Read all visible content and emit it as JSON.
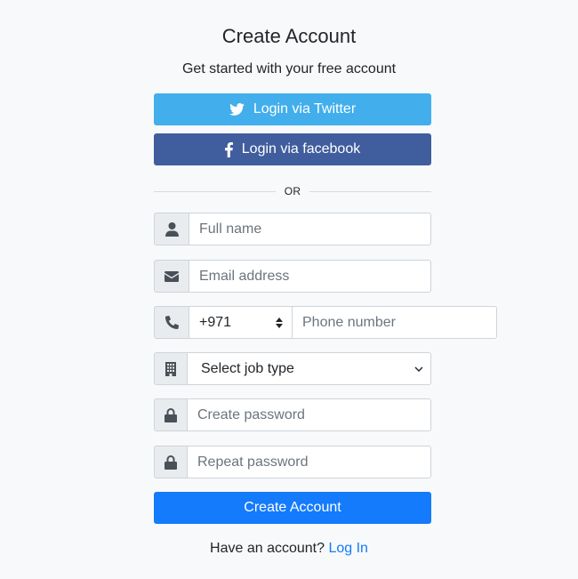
{
  "header": {
    "title": "Create Account",
    "subtitle": "Get started with your free account"
  },
  "social": {
    "twitter_label": "Login via Twitter",
    "facebook_label": "Login via facebook",
    "twitter_color": "#42aeec",
    "facebook_color": "#405d9d"
  },
  "divider": {
    "label": "OR"
  },
  "form": {
    "full_name": {
      "placeholder": "Full name",
      "icon": "user-icon"
    },
    "email": {
      "placeholder": "Email address",
      "icon": "envelope-icon"
    },
    "phone": {
      "icon": "phone-icon",
      "country_code": "+971",
      "placeholder": "Phone number"
    },
    "job_type": {
      "icon": "building-icon",
      "selected": "Select job type"
    },
    "password": {
      "placeholder": "Create password",
      "icon": "lock-icon"
    },
    "repeat_password": {
      "placeholder": "Repeat password",
      "icon": "lock-icon"
    },
    "submit_label": "Create Account",
    "primary_color": "#147bfc"
  },
  "footer": {
    "prompt": "Have an account?",
    "link_label": "Log In"
  }
}
